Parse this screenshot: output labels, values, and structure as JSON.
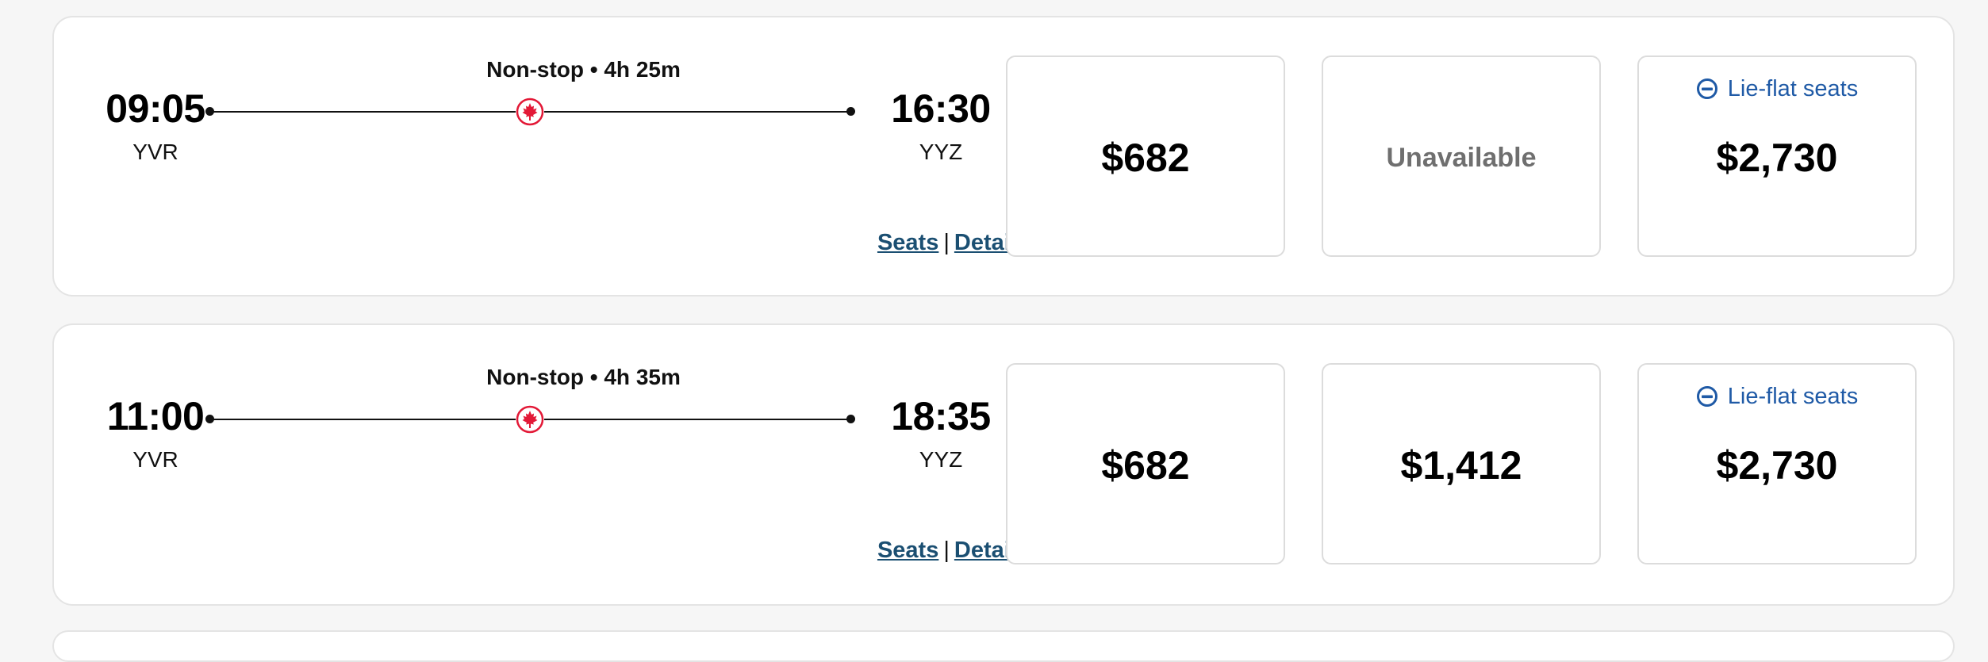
{
  "brand": {
    "logo_color": "#e31937",
    "link_color": "#1b4f72",
    "lieflat_color": "#1f5aa6"
  },
  "flights": [
    {
      "duration": "Non-stop • 4h 25m",
      "depart_time": "09:05",
      "depart_airport": "YVR",
      "arrive_time": "16:30",
      "arrive_airport": "YYZ",
      "seats_link": "Seats",
      "separator": "|",
      "details_link": "Details",
      "fares": [
        {
          "price": "$682"
        },
        {
          "status": "Unavailable"
        },
        {
          "badge": "Lie-flat seats",
          "badge_icon": "lie-flat-seat-icon",
          "price": "$2,730"
        }
      ]
    },
    {
      "duration": "Non-stop • 4h 35m",
      "depart_time": "11:00",
      "depart_airport": "YVR",
      "arrive_time": "18:35",
      "arrive_airport": "YYZ",
      "seats_link": "Seats",
      "separator": "|",
      "details_link": "Details",
      "fares": [
        {
          "price": "$682"
        },
        {
          "price": "$1,412"
        },
        {
          "badge": "Lie-flat seats",
          "badge_icon": "lie-flat-seat-icon",
          "price": "$2,730"
        }
      ]
    }
  ]
}
